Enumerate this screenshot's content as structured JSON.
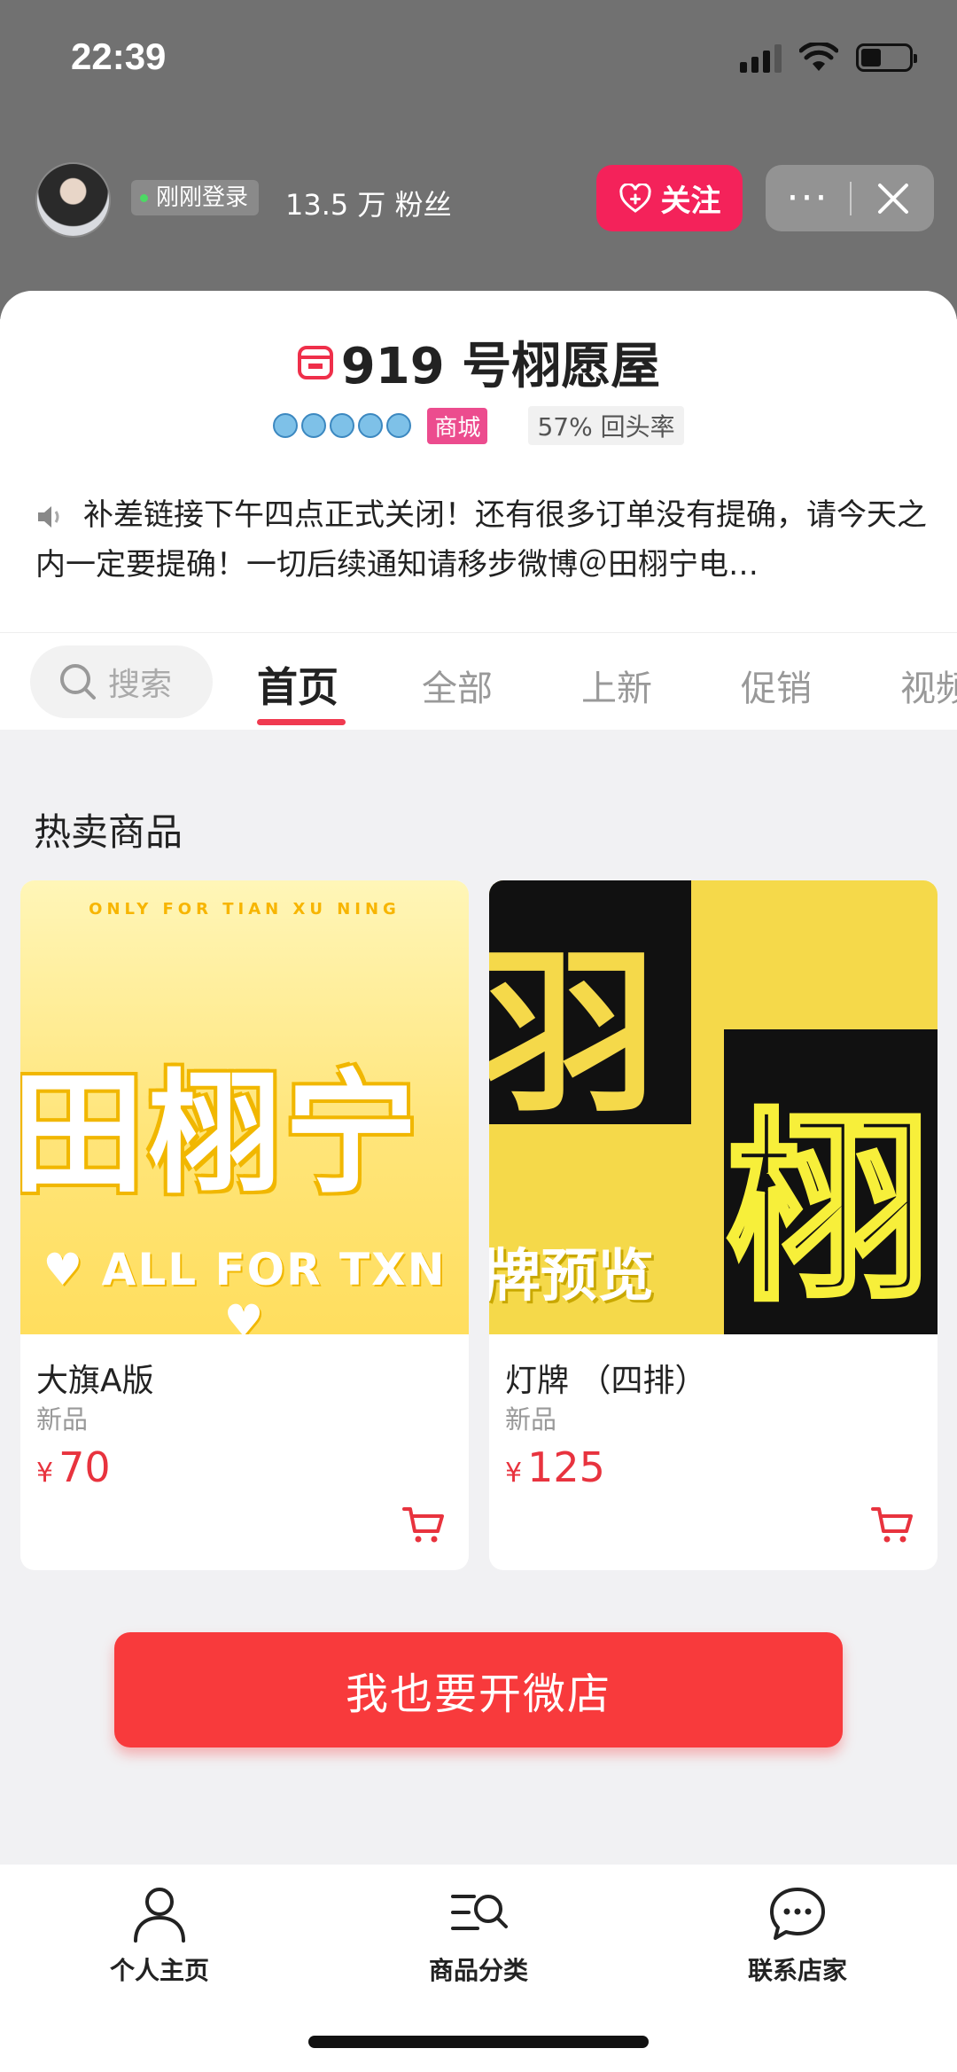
{
  "status_bar": {
    "time": "22:39"
  },
  "shop_header": {
    "login_status": "刚刚登录",
    "fans": "13.5 万 粉丝",
    "follow_label": "关注",
    "more_label": "···"
  },
  "shop": {
    "name": "919 号栩愿屋",
    "mall_tag": "商城",
    "repeat_rate": "57% 回头率",
    "notice": "补差链接下午四点正式关闭！还有很多订单没有提确，请今天之内一定要提确！一切后续通知请移步微博＠田栩宁电…"
  },
  "tabs": {
    "search_placeholder": "搜索",
    "items": [
      "首页",
      "全部",
      "上新",
      "促销",
      "视频"
    ],
    "active_index": 0
  },
  "section": {
    "hot_title": "热卖商品"
  },
  "products": [
    {
      "name": "大旗A版",
      "tag": "新品",
      "currency": "¥",
      "price": "70",
      "image_text": {
        "top": "ONLY FOR TIAN XU NING",
        "main": "田栩宁",
        "bottom": "♥ ALL FOR TXN ♥"
      }
    },
    {
      "name": "灯牌 （四排）",
      "tag": "新品",
      "currency": "¥",
      "price": "125",
      "image_text": {
        "glyph1": "羽",
        "glyph2": "栩",
        "caption": "牌预览"
      }
    }
  ],
  "cta": {
    "open_shop_label": "我也要开微店"
  },
  "bottom_nav": {
    "items": [
      {
        "label": "个人主页",
        "icon": "person-icon"
      },
      {
        "label": "商品分类",
        "icon": "category-search-icon"
      },
      {
        "label": "联系店家",
        "icon": "chat-bubble-icon"
      }
    ]
  },
  "colors": {
    "accent_red": "#f83a3c",
    "follow_pink": "#f4225a",
    "price_red": "#e8333e",
    "mall_pink": "#ec4c8e"
  }
}
